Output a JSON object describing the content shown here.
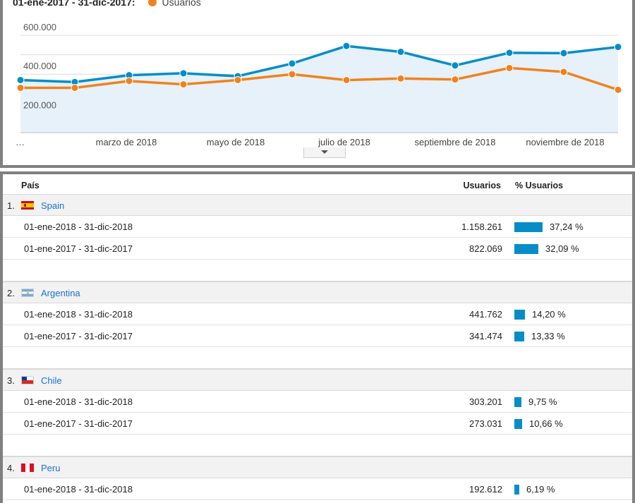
{
  "chart": {
    "legend": {
      "range_label": "01-ene-2017 - 31-dic-2017:",
      "series_label": "Usuarios"
    },
    "colors": {
      "current": "#058dc7",
      "previous": "#f0821e",
      "area": "#e6f1f9"
    },
    "y_ticks": [
      "600.000",
      "400.000",
      "200.000"
    ],
    "x_labels": [
      "…",
      "marzo de 2018",
      "mayo de 2018",
      "julio de 2018",
      "septiembre de 2018",
      "noviembre de 2018"
    ],
    "expand_icon": "chevron-down-icon"
  },
  "chart_data": {
    "type": "line",
    "ylabel": "",
    "xlabel": "",
    "ylim": [
      100000,
      600000
    ],
    "series": [
      {
        "values": [
          370000,
          360000,
          395000,
          405000,
          390000,
          455000,
          545000,
          515000,
          445000,
          510000,
          508000,
          540000
        ]
      },
      {
        "name": "Usuarios",
        "values": [
          330000,
          330000,
          365000,
          348000,
          370000,
          400000,
          370000,
          378000,
          373000,
          432000,
          412000,
          320000
        ]
      }
    ]
  },
  "table": {
    "headers": {
      "country": "País",
      "users": "Usuarios",
      "pct_users": "% Usuarios"
    },
    "countries": [
      {
        "index": "1.",
        "name": "Spain",
        "flag": "es",
        "rows": [
          {
            "range": "01-ene-2018 - 31-dic-2018",
            "value": "1.158.261",
            "pct": "37,24 %",
            "share": 0.3724
          },
          {
            "range": "01-ene-2017 - 31-dic-2017",
            "value": "822.069",
            "pct": "32,09 %",
            "share": 0.3209
          }
        ]
      },
      {
        "index": "2.",
        "name": "Argentina",
        "flag": "ar",
        "rows": [
          {
            "range": "01-ene-2018 - 31-dic-2018",
            "value": "441.762",
            "pct": "14,20 %",
            "share": 0.142
          },
          {
            "range": "01-ene-2017 - 31-dic-2017",
            "value": "341.474",
            "pct": "13,33 %",
            "share": 0.1333
          }
        ]
      },
      {
        "index": "3.",
        "name": "Chile",
        "flag": "cl",
        "rows": [
          {
            "range": "01-ene-2018 - 31-dic-2018",
            "value": "303.201",
            "pct": "9,75 %",
            "share": 0.0975
          },
          {
            "range": "01-ene-2017 - 31-dic-2017",
            "value": "273.031",
            "pct": "10,66 %",
            "share": 0.1066
          }
        ]
      },
      {
        "index": "4.",
        "name": "Peru",
        "flag": "pe",
        "rows": [
          {
            "range": "01-ene-2018 - 31-dic-2018",
            "value": "192.612",
            "pct": "6,19 %",
            "share": 0.0619
          }
        ]
      }
    ]
  }
}
